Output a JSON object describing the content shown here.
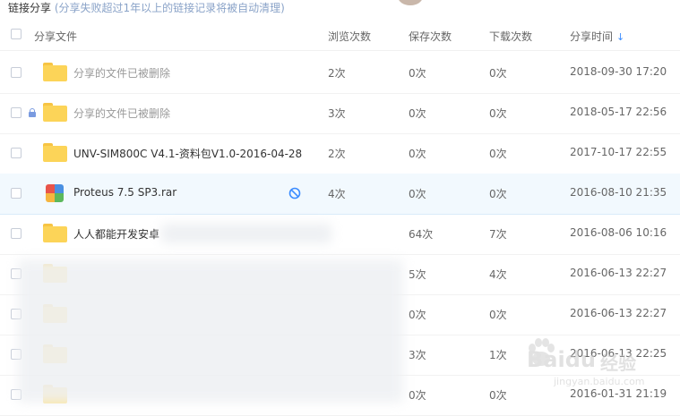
{
  "page": {
    "title": "链接分享",
    "notice": "(分享失败超过1年以上的链接记录将被自动清理)"
  },
  "table": {
    "columns": {
      "name": "分享文件",
      "views": "浏览次数",
      "saves": "保存次数",
      "downloads": "下载次数",
      "time": "分享时间"
    },
    "sort_indicator": "↓",
    "rows": [
      {
        "name": "分享的文件已被删除",
        "views": "2次",
        "saves": "0次",
        "downloads": "0次",
        "time": "2018-09-30 17:20",
        "icon": "folder-icon",
        "deleted": true,
        "locked": false
      },
      {
        "name": "分享的文件已被删除",
        "views": "3次",
        "saves": "0次",
        "downloads": "0次",
        "time": "2018-05-17 22:56",
        "icon": "folder-icon",
        "deleted": true,
        "locked": true
      },
      {
        "name": "UNV-SIM800C V4.1-资料包V1.0-2016-04-28",
        "views": "2次",
        "saves": "0次",
        "downloads": "0次",
        "time": "2017-10-17 22:55",
        "icon": "folder-icon",
        "deleted": false,
        "locked": false
      },
      {
        "name": "Proteus 7.5 SP3.rar",
        "views": "4次",
        "saves": "0次",
        "downloads": "0次",
        "time": "2016-08-10 21:35",
        "icon": "rar-file-icon",
        "deleted": false,
        "locked": false,
        "selected": true
      },
      {
        "name": "人人都能开发安卓",
        "views": "",
        "saves": "64次",
        "downloads": "7次",
        "time": "2016-08-06 10:16",
        "icon": "folder-icon",
        "deleted": false,
        "locked": false
      },
      {
        "name": "",
        "views": "",
        "saves": "5次",
        "downloads": "4次",
        "time": "2016-06-13 22:27",
        "icon": "folder-icon",
        "deleted": false,
        "locked": false
      },
      {
        "name": "",
        "views": "",
        "saves": "0次",
        "downloads": "0次",
        "time": "2016-06-13 22:27",
        "icon": "folder-icon",
        "deleted": false,
        "locked": false
      },
      {
        "name": "",
        "views": "",
        "saves": "3次",
        "downloads": "1次",
        "time": "2016-06-13 22:25",
        "icon": "folder-icon",
        "deleted": false,
        "locked": false
      },
      {
        "name": "",
        "views": "",
        "saves": "0次",
        "downloads": "0次",
        "time": "2016-01-31 21:19",
        "icon": "folder-icon",
        "deleted": false,
        "locked": false
      }
    ]
  },
  "watermark": {
    "brand": "Baidu",
    "brand_cn": "经验",
    "url": "jingyan.baidu.com"
  },
  "colors": {
    "accent": "#3b8cff",
    "folder": "#fcd458",
    "selected_row": "#f2f9fe"
  }
}
